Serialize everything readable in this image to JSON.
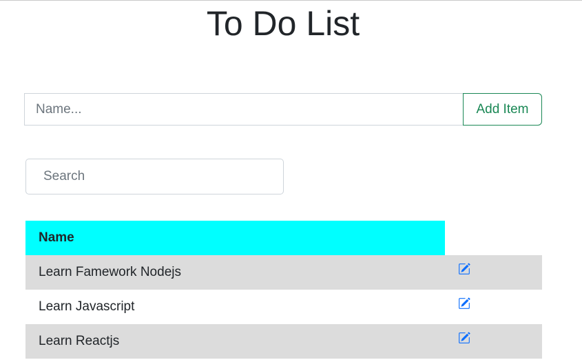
{
  "page": {
    "title": "To Do List"
  },
  "add_form": {
    "name_placeholder": "Name...",
    "name_value": "",
    "add_label": "Add Item"
  },
  "search": {
    "placeholder": "Search",
    "value": ""
  },
  "table": {
    "headers": [
      "Name",
      ""
    ],
    "rows": [
      {
        "name": "Learn Famework Nodejs",
        "action_icon": "edit-icon"
      },
      {
        "name": "Learn Javascript",
        "action_icon": "edit-icon"
      },
      {
        "name": "Learn Reactjs",
        "action_icon": "edit-icon"
      }
    ]
  },
  "colors": {
    "header_bg": "#00ffff",
    "stripe_bg": "#dcdcdc",
    "add_button": "#198754",
    "edit_icon": "#0d6efd"
  }
}
